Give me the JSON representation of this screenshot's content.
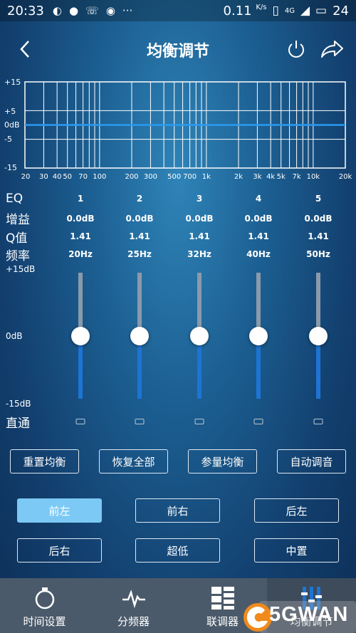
{
  "status_bar": {
    "time": "20:33",
    "net_speed": "0.11",
    "net_unit": "K/s",
    "signal": "4G",
    "battery": "24",
    "icons": [
      "weibo-icon",
      "chat-bubble-icon",
      "missed-call-icon",
      "face-app-icon",
      "more-icon"
    ]
  },
  "header": {
    "title": "均衡调节",
    "back_icon": "back-chevron-icon",
    "power_icon": "power-icon",
    "share_icon": "share-icon"
  },
  "graph": {
    "y_labels": [
      "+15",
      "+5",
      "0dB",
      "-5",
      "-15"
    ],
    "x_labels": [
      "20",
      "30",
      "40",
      "50",
      "70",
      "100",
      "200",
      "300",
      "500",
      "700",
      "1k",
      "2k",
      "3k",
      "4k",
      "5k",
      "7k",
      "10k",
      "20k"
    ],
    "curve_db": 0
  },
  "eq_table": {
    "labels": {
      "eq": "EQ",
      "gain": "增益",
      "q": "Q值",
      "freq": "频率"
    },
    "bands": [
      {
        "num": "1",
        "gain": "0.0dB",
        "q": "1.41",
        "freq": "20Hz",
        "gain_db": 0
      },
      {
        "num": "2",
        "gain": "0.0dB",
        "q": "1.41",
        "freq": "25Hz",
        "gain_db": 0
      },
      {
        "num": "3",
        "gain": "0.0dB",
        "q": "1.41",
        "freq": "32Hz",
        "gain_db": 0
      },
      {
        "num": "4",
        "gain": "0.0dB",
        "q": "1.41",
        "freq": "40Hz",
        "gain_db": 0
      },
      {
        "num": "5",
        "gain": "0.0dB",
        "q": "1.41",
        "freq": "50Hz",
        "gain_db": 0
      }
    ]
  },
  "slider_labels": {
    "max": "+15dB",
    "mid": "0dB",
    "min": "-15dB",
    "bypass": "直通"
  },
  "actions": [
    "重置均衡",
    "恢复全部",
    "参量均衡",
    "自动调音"
  ],
  "channels": {
    "items": [
      "前左",
      "前右",
      "后左",
      "后右",
      "超低",
      "中置"
    ],
    "selected": "前左"
  },
  "nav": {
    "items": [
      {
        "label": "时间设置",
        "icon": "stopwatch-icon"
      },
      {
        "label": "分频器",
        "icon": "pulse-icon"
      },
      {
        "label": "联调器",
        "icon": "grid-layout-icon"
      },
      {
        "label": "均衡调节",
        "icon": "equalizer-icon"
      }
    ],
    "active": 3
  },
  "watermark": "5GWAN",
  "colors": {
    "accent": "#7cc9f5",
    "curve": "#2b9af0",
    "track_active": "#1d74d4",
    "nav_bg": "#4b5a6a"
  }
}
